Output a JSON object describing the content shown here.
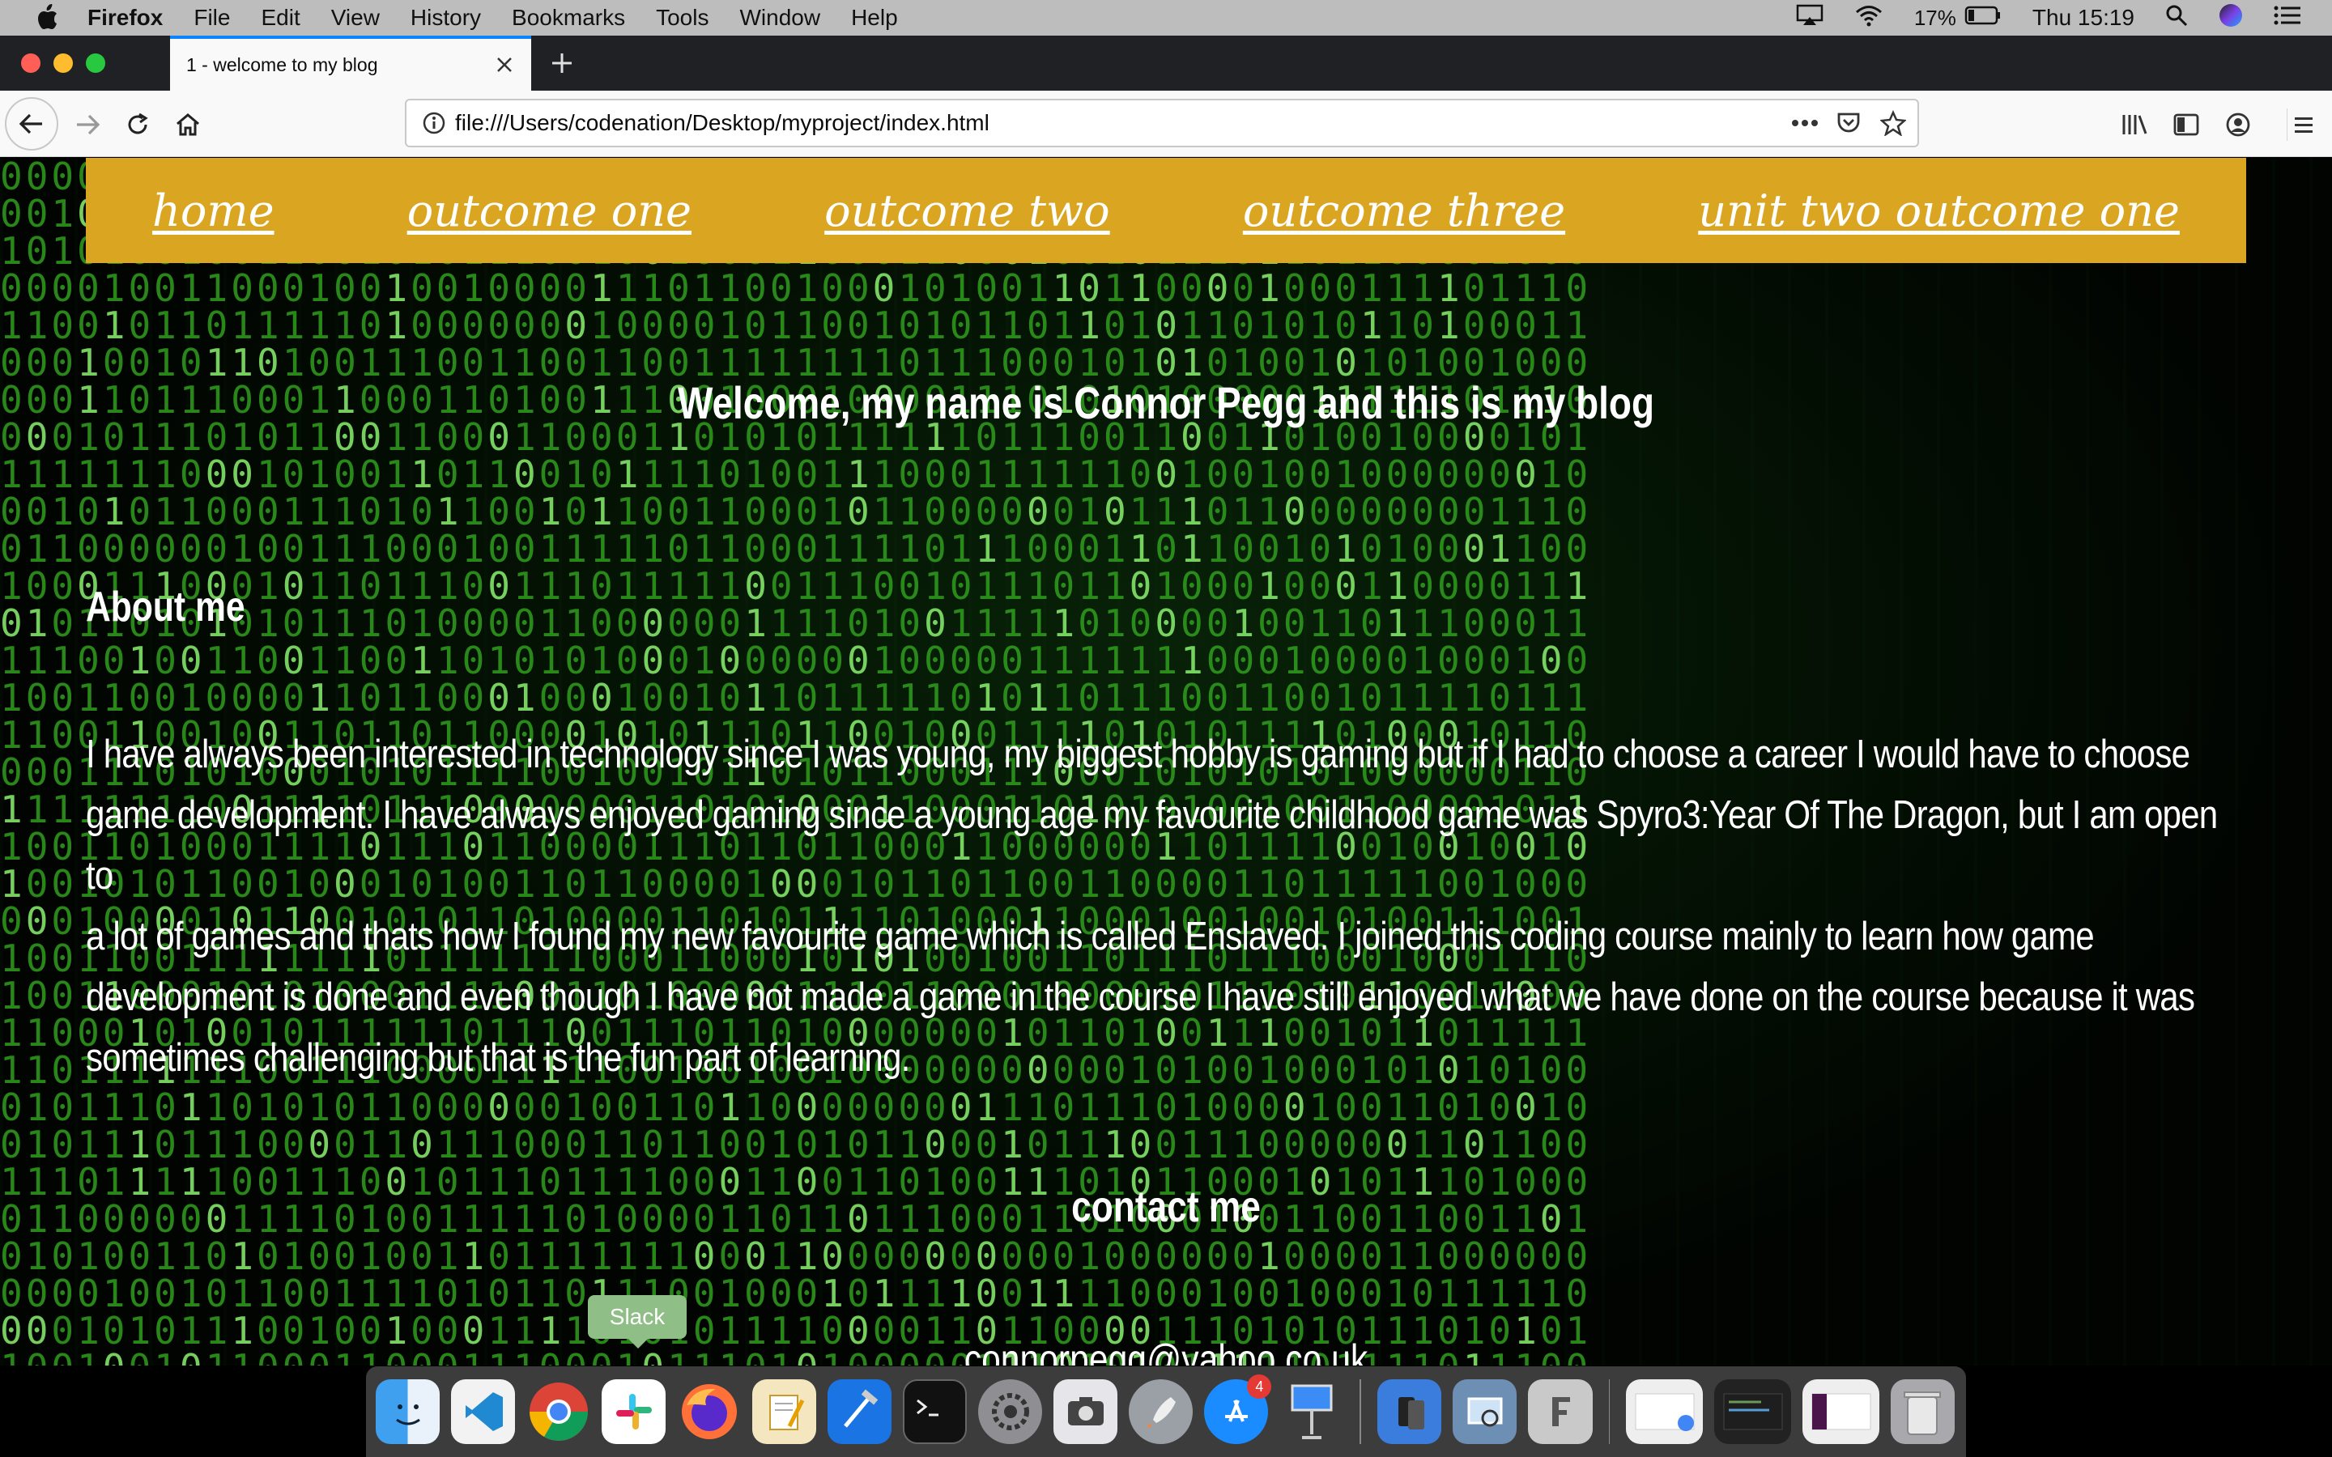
{
  "menubar": {
    "app_name": "Firefox",
    "items": [
      "File",
      "Edit",
      "View",
      "History",
      "Bookmarks",
      "Tools",
      "Window",
      "Help"
    ],
    "battery": "17%",
    "clock": "Thu 15:19"
  },
  "browser": {
    "tab_title": "1 - welcome to my blog",
    "url": "file:///Users/codenation/Desktop/myproject/index.html"
  },
  "site": {
    "nav": [
      "home",
      "outcome one",
      "outcome two",
      "outcome three",
      "unit two outcome one"
    ],
    "welcome": "Welcome, my name is Connor Pegg and this is my blog",
    "about_heading": "About me",
    "about_text_lines": [
      "I have always been interested in technology since I was young, my biggest hobby is gaming but if I had to choose a career I would have to choose",
      "game development. I have always enjoyed gaming since a young age my favourite childhood game was Spyro3:Year Of The Dragon, but I am open to",
      "a lot of games and thats how I found my new favourite game which is called Enslaved. I joined this coding course mainly to learn how game",
      "development is done and even though I have not made a game in the course I have still enjoyed what we have done on the course because it was",
      "sometimes challenging but that is the fun part of learning."
    ],
    "contact_heading": "contact me",
    "email": "connorpegg@yahoo.co.uk"
  },
  "dock": {
    "tooltip": "Slack",
    "appstore_badge": "4"
  },
  "colors": {
    "nav_bar": "#daa520",
    "matrix_green": "#2f9e1d",
    "tab_accent": "#0a84ff"
  }
}
